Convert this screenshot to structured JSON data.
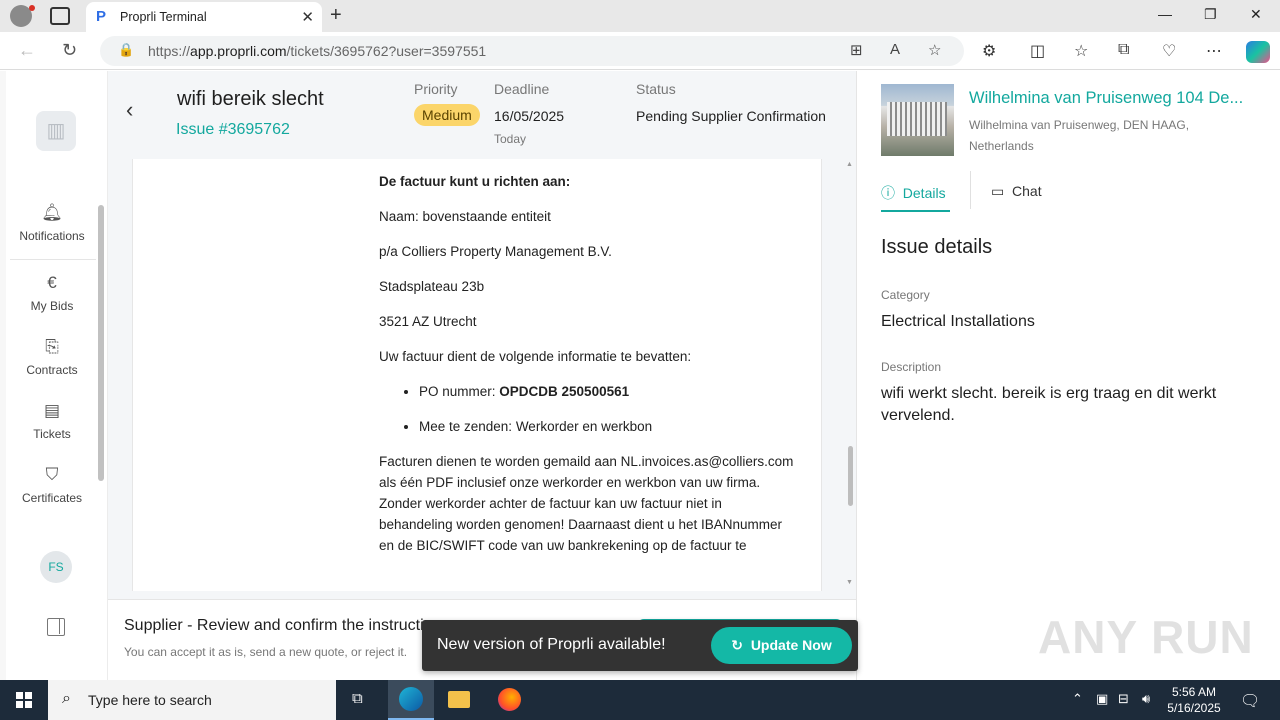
{
  "browser": {
    "tab_title": "Proprli Terminal",
    "url_prefix": "https://",
    "url_host": "app.proprli.com",
    "url_path": "/tickets/3695762?user=3597551"
  },
  "sidebar": {
    "items": [
      {
        "label": "Notifications",
        "icon": "bell-icon"
      },
      {
        "label": "My Bids",
        "icon": "euro-icon"
      },
      {
        "label": "Contracts",
        "icon": "contracts-icon"
      },
      {
        "label": "Tickets",
        "icon": "tickets-icon"
      },
      {
        "label": "Certificates",
        "icon": "certificate-icon"
      }
    ],
    "avatar_initials": "FS"
  },
  "header": {
    "title": "wifi bereik slecht",
    "issue_number": "Issue #3695762",
    "priority_label": "Priority",
    "priority_value": "Medium",
    "deadline_label": "Deadline",
    "deadline_value": "16/05/2025",
    "deadline_sub": "Today",
    "status_label": "Status",
    "status_value": "Pending Supplier Confirmation"
  },
  "document": {
    "heading": "De factuur kunt u richten aan:",
    "lines": [
      "Naam: bovenstaande entiteit",
      "p/a Colliers Property Management B.V.",
      "Stadsplateau 23b",
      "3521 AZ Utrecht",
      "Uw factuur dient de volgende informatie te bevatten:"
    ],
    "bullet1_label": "PO nummer: ",
    "bullet1_value": "OPDCDB 250500561",
    "bullet2": "Mee te zenden: Werkorder en werkbon",
    "paragraph": "Facturen dienen te worden gemaild aan NL.invoices.as@colliers.com als één PDF inclusief onze werkorder en werkbon van uw firma. Zonder werkorder achter de factuur kan uw factuur niet in behandeling worden genomen! Daarnaast dient u het IBANnummer en de BIC/SWIFT code van uw bankrekening op de factuur te"
  },
  "footer": {
    "title": "Supplier - Review and confirm the instructi",
    "subtitle": "You can accept it as is, send a new quote, or reject it."
  },
  "toast": {
    "message": "New version of Proprli available!",
    "button": "Update Now"
  },
  "property": {
    "name": "Wilhelmina van Pruisenweg 104 De...",
    "address": "Wilhelmina van Pruisenweg, DEN HAAG, Netherlands"
  },
  "details": {
    "tab_details": "Details",
    "tab_chat": "Chat",
    "section_title": "Issue details",
    "category_label": "Category",
    "category_value": "Electrical Installations",
    "description_label": "Description",
    "description_value": "wifi werkt slecht. bereik is erg traag en dit werkt vervelend."
  },
  "watermark": "ANY RUN",
  "taskbar": {
    "search_placeholder": "Type here to search",
    "time": "5:56 AM",
    "date": "5/16/2025"
  },
  "colors": {
    "accent": "#13a89e",
    "priority_badge": "#fbd56a",
    "toast_bg": "#333333",
    "taskbar": "#1d2b3a"
  }
}
